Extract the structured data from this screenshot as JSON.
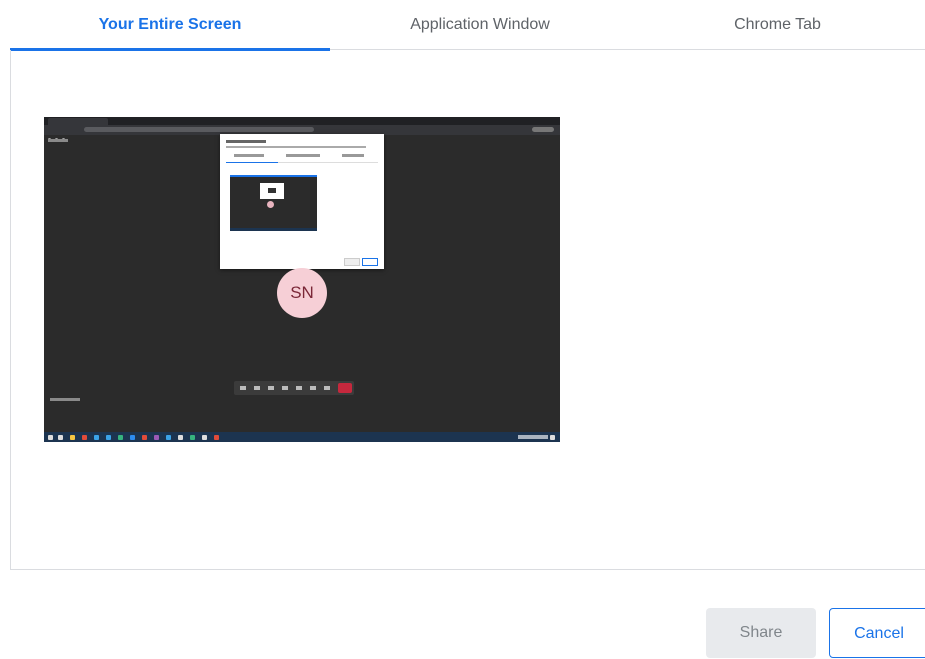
{
  "tabs": [
    {
      "label": "Your Entire Screen",
      "active": true
    },
    {
      "label": "Application Window",
      "active": false
    },
    {
      "label": "Chrome Tab",
      "active": false
    }
  ],
  "preview": {
    "avatar_initials": "SN"
  },
  "buttons": {
    "share": "Share",
    "cancel": "Cancel"
  },
  "colors": {
    "accent": "#1a73e8",
    "share_disabled_bg": "#e8eaed",
    "preview_bg": "#2b2b2b",
    "avatar_bg": "#f6cfd6",
    "avatar_text": "#7a2737",
    "end_call": "#c5283d"
  }
}
